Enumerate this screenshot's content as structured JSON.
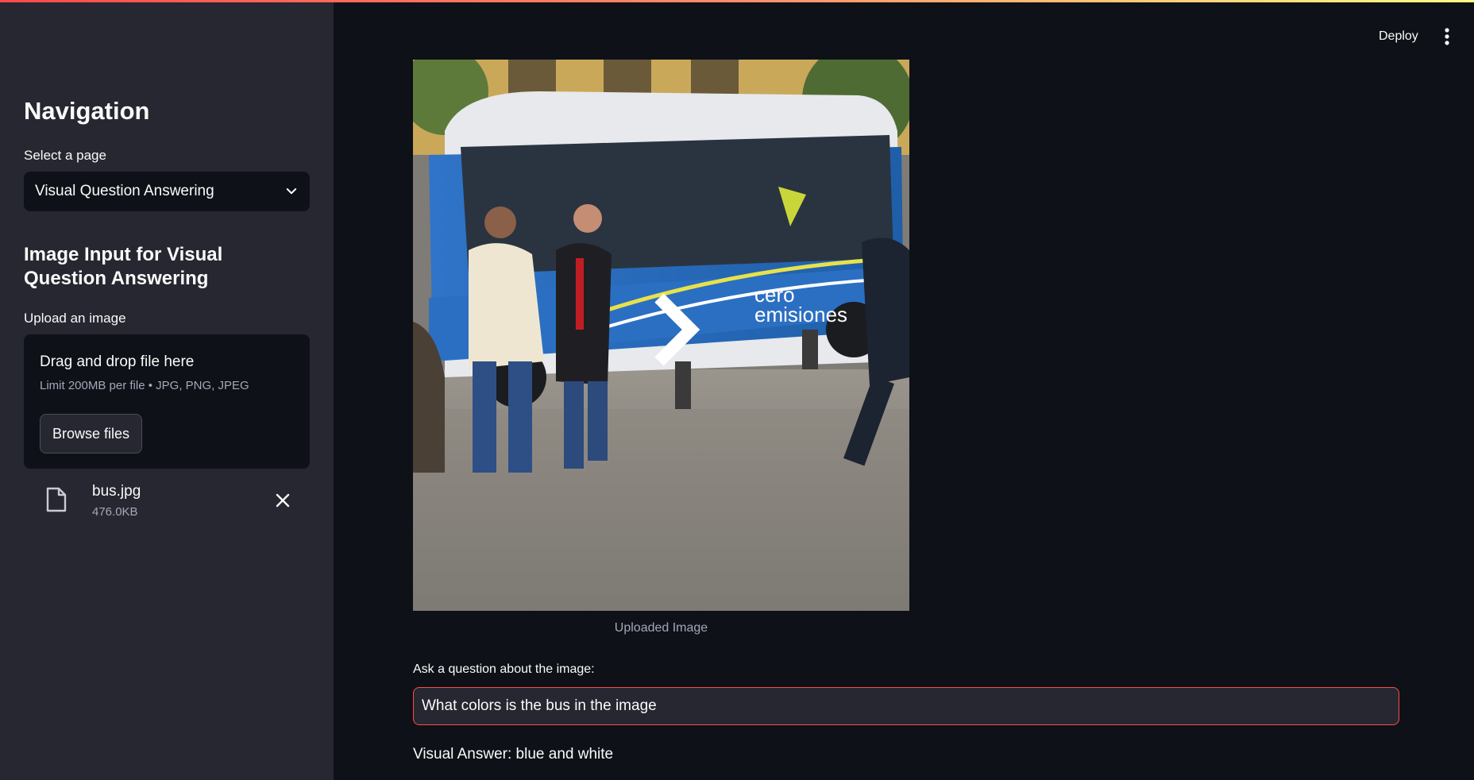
{
  "sidebar": {
    "title": "Navigation",
    "select_label": "Select a page",
    "selected_page": "Visual Question Answering",
    "section_title": "Image Input for Visual Question Answering",
    "upload_label": "Upload an image",
    "dropzone": {
      "title": "Drag and drop file here",
      "limit": "Limit 200MB per file • JPG, PNG, JPEG",
      "browse_label": "Browse files"
    },
    "file": {
      "name": "bus.jpg",
      "size": "476.0KB"
    }
  },
  "header": {
    "deploy_label": "Deploy",
    "menu_icon": "kebab-menu-icon"
  },
  "main": {
    "image_caption": "Uploaded Image",
    "question_label": "Ask a question about the image:",
    "question_value": "What colors is the bus in the image",
    "answer": "Visual Answer: blue and white"
  },
  "colors": {
    "background": "#0e1117",
    "sidebar": "#262730",
    "accent": "#ff4b4b",
    "muted_text": "#a3a8b8",
    "bus_blue": "#2b6fc2"
  }
}
